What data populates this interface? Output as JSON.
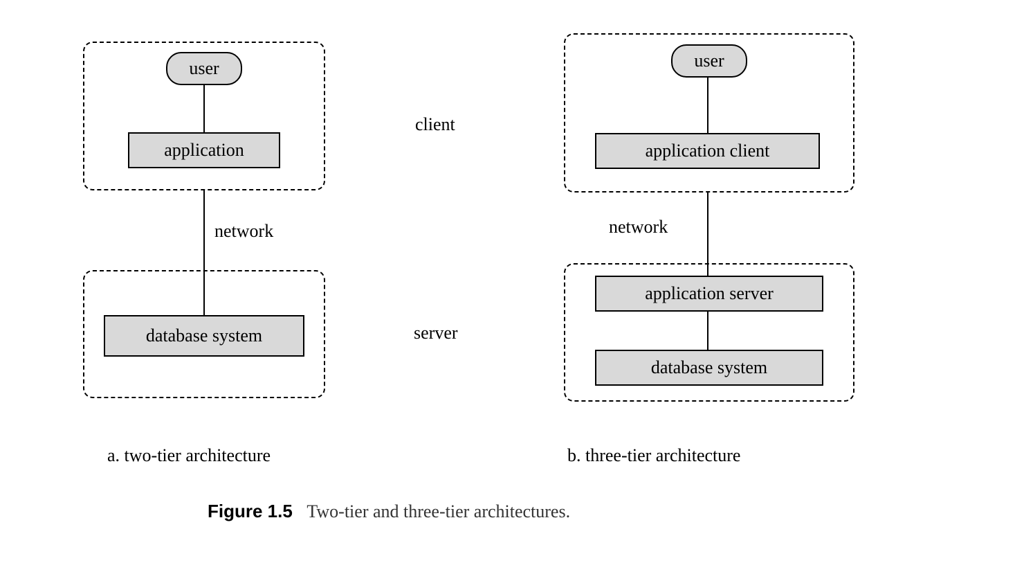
{
  "middle": {
    "client": "client",
    "server": "server"
  },
  "left": {
    "user": "user",
    "application": "application",
    "network": "network",
    "database": "database system",
    "caption": "a.  two-tier architecture"
  },
  "right": {
    "user": "user",
    "appclient": "application client",
    "network": "network",
    "appserver": "application server",
    "database": "database system",
    "caption": "b.  three-tier architecture"
  },
  "figure": {
    "num": "Figure 1.5",
    "title": "Two-tier and three-tier architectures."
  }
}
